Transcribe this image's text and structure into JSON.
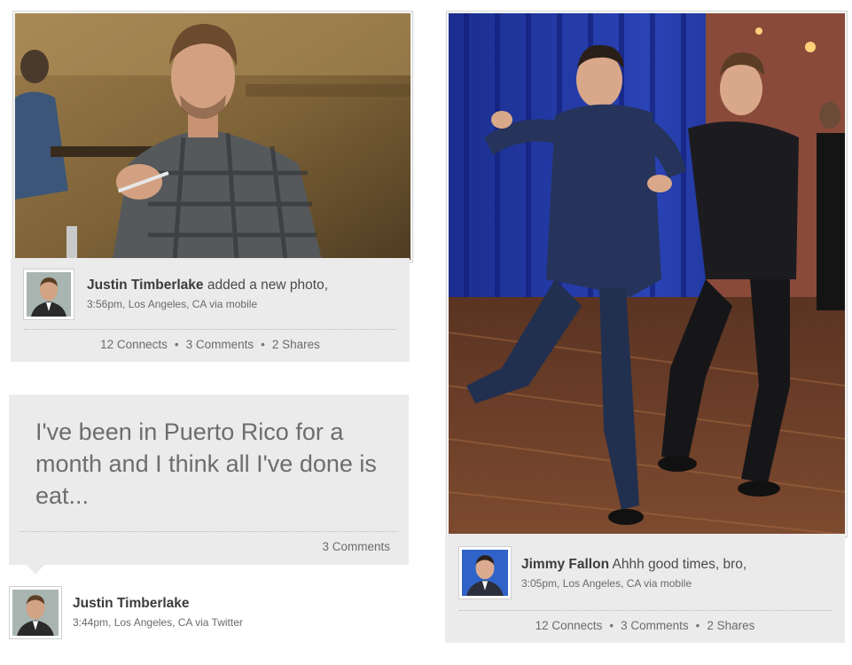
{
  "post1": {
    "author": "Justin Timberlake",
    "action": "added a new photo,",
    "meta": "3:56pm, Los Angeles, CA via mobile",
    "stats": {
      "connects": "12 Connects",
      "comments": "3 Comments",
      "shares": "2 Shares"
    },
    "separator": "•"
  },
  "post2": {
    "text": "I've been in Puerto Rico for a month and I think all I've done is eat...",
    "comments": "3 Comments",
    "author": "Justin Timberlake",
    "meta": "3:44pm, Los Angeles, CA via Twitter"
  },
  "post3": {
    "author": "Jimmy Fallon",
    "action": "Ahhh good times, bro,",
    "meta": "3:05pm, Los Angeles, CA via mobile",
    "stats": {
      "connects": "12 Connects",
      "comments": "3 Comments",
      "shares": "2 Shares"
    },
    "separator": "•"
  },
  "colors": {
    "card_bg": "#ebebeb",
    "name_text": "#3b3b3b",
    "muted_text": "#6b6b6b"
  },
  "icons": [
    "avatar-justin-timberlake",
    "avatar-jimmy-fallon"
  ]
}
